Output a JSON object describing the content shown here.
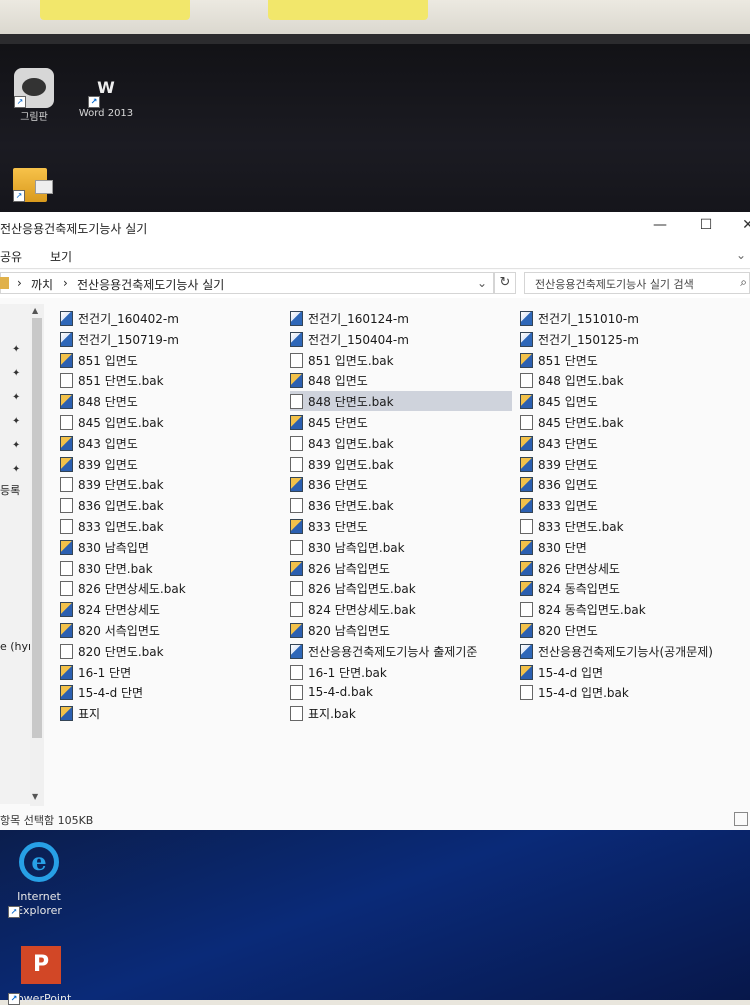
{
  "desktop_top": {
    "icons": [
      {
        "name": "paint-app-icon",
        "label": "그림판"
      },
      {
        "name": "word-2013-icon",
        "label": "Word 2013"
      },
      {
        "name": "folder-shortcut-icon",
        "label": ""
      }
    ]
  },
  "window": {
    "title": "전산응용건축제도기능사 실기",
    "controls": {
      "minimize": "—",
      "maximize": "☐",
      "close": "✕"
    },
    "ribbon_tabs": [
      "공유",
      "보기"
    ],
    "address": {
      "segments": [
        "까치",
        "전산응용건축제도기능사 실기"
      ],
      "separator": "›"
    },
    "search_placeholder": "전산응용건축제도기능사 실기 검색",
    "nav_labels": [
      "등록",
      "e (hyr"
    ],
    "status": "항목 선택함 105KB",
    "columns": [
      [
        {
          "name": "전건기_160402-m",
          "type": "dwf"
        },
        {
          "name": "전건기_150719-m",
          "type": "dwf"
        },
        {
          "name": "851 입면도",
          "type": "dwg"
        },
        {
          "name": "851 단면도.bak",
          "type": "doc"
        },
        {
          "name": "848 단면도",
          "type": "dwg"
        },
        {
          "name": "845 입면도.bak",
          "type": "doc"
        },
        {
          "name": "843 입면도",
          "type": "dwg"
        },
        {
          "name": "839 입면도",
          "type": "dwg"
        },
        {
          "name": "839 단면도.bak",
          "type": "doc"
        },
        {
          "name": "836 입면도.bak",
          "type": "doc"
        },
        {
          "name": "833 입면도.bak",
          "type": "doc"
        },
        {
          "name": "830 남측입면",
          "type": "dwg"
        },
        {
          "name": "830 단면.bak",
          "type": "doc"
        },
        {
          "name": "826 단면상세도.bak",
          "type": "doc"
        },
        {
          "name": "824 단면상세도",
          "type": "dwg"
        },
        {
          "name": "820 서측입면도",
          "type": "dwg"
        },
        {
          "name": "820 단면도.bak",
          "type": "doc"
        },
        {
          "name": "16-1 단면",
          "type": "dwg"
        },
        {
          "name": "15-4-d 단면",
          "type": "dwg"
        },
        {
          "name": "표지",
          "type": "dwg"
        }
      ],
      [
        {
          "name": "전건기_160124-m",
          "type": "dwf"
        },
        {
          "name": "전건기_150404-m",
          "type": "dwf"
        },
        {
          "name": "851 입면도.bak",
          "type": "doc"
        },
        {
          "name": "848 입면도",
          "type": "dwg"
        },
        {
          "name": "848 단면도.bak",
          "type": "doc",
          "selected": true
        },
        {
          "name": "845 단면도",
          "type": "dwg"
        },
        {
          "name": "843 입면도.bak",
          "type": "doc"
        },
        {
          "name": "839 입면도.bak",
          "type": "doc"
        },
        {
          "name": "836 단면도",
          "type": "dwg"
        },
        {
          "name": "836 단면도.bak",
          "type": "doc"
        },
        {
          "name": "833 단면도",
          "type": "dwg"
        },
        {
          "name": "830 남측입면.bak",
          "type": "doc"
        },
        {
          "name": "826 남측입면도",
          "type": "dwg"
        },
        {
          "name": "826 남측입면도.bak",
          "type": "doc"
        },
        {
          "name": "824 단면상세도.bak",
          "type": "doc"
        },
        {
          "name": "820 남측입면도",
          "type": "dwg"
        },
        {
          "name": "전산응용건축제도기능사 출제기준",
          "type": "dwf"
        },
        {
          "name": "16-1 단면.bak",
          "type": "doc"
        },
        {
          "name": "15-4-d.bak",
          "type": "doc"
        },
        {
          "name": "표지.bak",
          "type": "doc"
        }
      ],
      [
        {
          "name": "전건기_151010-m",
          "type": "dwf"
        },
        {
          "name": "전건기_150125-m",
          "type": "dwf"
        },
        {
          "name": "851 단면도",
          "type": "dwg"
        },
        {
          "name": "848 입면도.bak",
          "type": "doc"
        },
        {
          "name": "845 입면도",
          "type": "dwg"
        },
        {
          "name": "845 단면도.bak",
          "type": "doc"
        },
        {
          "name": "843 단면도",
          "type": "dwg"
        },
        {
          "name": "839 단면도",
          "type": "dwg"
        },
        {
          "name": "836 입면도",
          "type": "dwg"
        },
        {
          "name": "833 입면도",
          "type": "dwg"
        },
        {
          "name": "833 단면도.bak",
          "type": "doc"
        },
        {
          "name": "830 단면",
          "type": "dwg"
        },
        {
          "name": "826 단면상세도",
          "type": "dwg"
        },
        {
          "name": "824 동측입면도",
          "type": "dwg"
        },
        {
          "name": "824 동측입면도.bak",
          "type": "doc"
        },
        {
          "name": "820 단면도",
          "type": "dwg"
        },
        {
          "name": "전산응용건축제도기능사(공개문제)",
          "type": "dwf"
        },
        {
          "name": "15-4-d 입면",
          "type": "dwg"
        },
        {
          "name": "15-4-d 입면.bak",
          "type": "doc"
        }
      ]
    ]
  },
  "desktop_bottom": {
    "icons": [
      {
        "name": "internet-explorer-icon",
        "label": "Internet Explorer"
      },
      {
        "name": "powerpoint-icon",
        "label": "PowerPoint"
      }
    ]
  }
}
